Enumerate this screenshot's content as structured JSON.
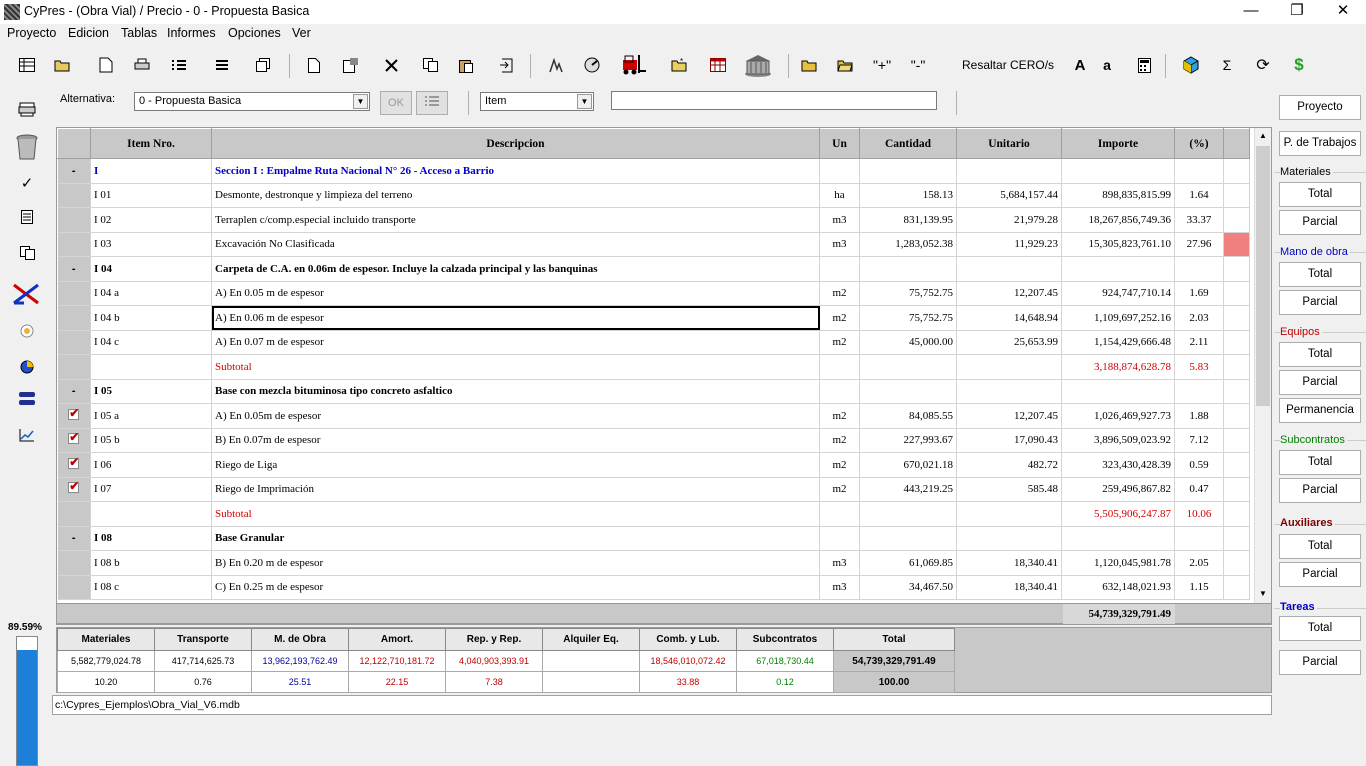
{
  "window": {
    "title": "CyPres  - (Obra Vial) / Precio - 0 - Propuesta Basica",
    "min_icon": "—",
    "max_icon": "❐",
    "close_icon": "✕"
  },
  "menu": [
    "Proyecto",
    "Edicion",
    "Tablas",
    "Informes",
    "Opciones",
    "Ver"
  ],
  "toolbar": {
    "resaltar_label": "Resaltar CERO/s",
    "font_large": "A",
    "font_small": "a",
    "sigma": "Σ",
    "dollar": "$",
    "plus": "\"+\"",
    "minus": "\"-\""
  },
  "alternativa": {
    "label": "Alternativa:",
    "value": "0 - Propuesta Basica",
    "ok_label": "OK",
    "field_value": "Item",
    "search_value": ""
  },
  "grid": {
    "columns": [
      "Item Nro.",
      "Descripcion",
      "Un",
      "Cantidad",
      "Unitario",
      "Importe",
      "(%)"
    ],
    "rows": [
      {
        "type": "section",
        "rh": "-",
        "code": "I",
        "desc": "Seccion I : Empalme Ruta Nacional N° 26 - Acceso a Barrio",
        "un": "",
        "cant": "",
        "unit": "",
        "imp": "",
        "pct": ""
      },
      {
        "type": "item",
        "rh": "",
        "code": "I 01",
        "desc": "Desmonte, destronque y limpieza del terreno",
        "un": "ha",
        "cant": "158.13",
        "unit": "5,684,157.44",
        "imp": "898,835,815.99",
        "pct": "1.64"
      },
      {
        "type": "item",
        "rh": "",
        "code": "I 02",
        "desc": "Terraplen c/comp.especial incluido transporte",
        "un": "m3",
        "cant": "831,139.95",
        "unit": "21,979.28",
        "imp": "18,267,856,749.36",
        "pct": "33.37"
      },
      {
        "type": "item",
        "rh": "",
        "code": "I 03",
        "desc": "Excavación No Clasificada",
        "un": "m3",
        "cant": "1,283,052.38",
        "unit": "11,929.23",
        "imp": "15,305,823,761.10",
        "pct": "27.96",
        "flag": true
      },
      {
        "type": "group",
        "rh": "-",
        "code": "I 04",
        "desc": "Carpeta de C.A. en 0.06m de espesor. Incluye la calzada principal y las banquinas",
        "un": "",
        "cant": "",
        "unit": "",
        "imp": "",
        "pct": ""
      },
      {
        "type": "item",
        "rh": "",
        "code": "I 04 a",
        "desc": "A) En 0.05 m de espesor",
        "un": "m2",
        "cant": "75,752.75",
        "unit": "12,207.45",
        "imp": "924,747,710.14",
        "pct": "1.69"
      },
      {
        "type": "item",
        "rh": "",
        "code": "I 04 b",
        "desc": "A) En 0.06 m de espesor",
        "un": "m2",
        "cant": "75,752.75",
        "unit": "14,648.94",
        "imp": "1,109,697,252.16",
        "pct": "2.03",
        "selected": true
      },
      {
        "type": "item",
        "rh": "",
        "code": "I 04 c",
        "desc": "A) En 0.07 m de espesor",
        "un": "m2",
        "cant": "45,000.00",
        "unit": "25,653.99",
        "imp": "1,154,429,666.48",
        "pct": "2.11"
      },
      {
        "type": "subtotal",
        "rh": "",
        "code": "",
        "desc": "Subtotal",
        "un": "",
        "cant": "",
        "unit": "",
        "imp": "3,188,874,628.78",
        "pct": "5.83"
      },
      {
        "type": "group",
        "rh": "-",
        "code": "I 05",
        "desc": "Base con mezcla bituminosa tipo concreto asfaltico",
        "un": "",
        "cant": "",
        "unit": "",
        "imp": "",
        "pct": ""
      },
      {
        "type": "item",
        "rh": "chk",
        "code": "I 05 a",
        "desc": "A) En 0.05m de espesor",
        "un": "m2",
        "cant": "84,085.55",
        "unit": "12,207.45",
        "imp": "1,026,469,927.73",
        "pct": "1.88"
      },
      {
        "type": "item",
        "rh": "chk",
        "code": "I 05 b",
        "desc": "B) En 0.07m de espesor",
        "un": "m2",
        "cant": "227,993.67",
        "unit": "17,090.43",
        "imp": "3,896,509,023.92",
        "pct": "7.12"
      },
      {
        "type": "item",
        "rh": "chk",
        "code": "I 06",
        "desc": "Riego de Liga",
        "un": "m2",
        "cant": "670,021.18",
        "unit": "482.72",
        "imp": "323,430,428.39",
        "pct": "0.59"
      },
      {
        "type": "item",
        "rh": "chk",
        "code": "I 07",
        "desc": "Riego de Imprimación",
        "un": "m2",
        "cant": "443,219.25",
        "unit": "585.48",
        "imp": "259,496,867.82",
        "pct": "0.47"
      },
      {
        "type": "subtotal",
        "rh": "",
        "code": "",
        "desc": "Subtotal",
        "un": "",
        "cant": "",
        "unit": "",
        "imp": "5,505,906,247.87",
        "pct": "10.06"
      },
      {
        "type": "group",
        "rh": "-",
        "code": "I 08",
        "desc": "Base Granular",
        "un": "",
        "cant": "",
        "unit": "",
        "imp": "",
        "pct": ""
      },
      {
        "type": "item",
        "rh": "",
        "code": "I 08 b",
        "desc": "B) En 0.20 m de espesor",
        "un": "m3",
        "cant": "61,069.85",
        "unit": "18,340.41",
        "imp": "1,120,045,981.78",
        "pct": "2.05"
      },
      {
        "type": "item",
        "rh": "",
        "code": "I 08 c",
        "desc": "C) En 0.25 m de espesor",
        "un": "m3",
        "cant": "34,467.50",
        "unit": "18,340.41",
        "imp": "632,148,021.93",
        "pct": "1.15"
      }
    ],
    "grand_total": "54,739,329,791.49"
  },
  "summary": {
    "headers": [
      "Materiales",
      "Transporte",
      "M. de Obra",
      "Amort.",
      "Rep. y Rep.",
      "Alquiler Eq.",
      "Comb. y Lub.",
      "Subcontratos",
      "Total"
    ],
    "values": [
      "5,582,779,024.78",
      "417,714,625.73",
      "13,962,193,762.49",
      "12,122,710,181.72",
      "4,040,903,393.91",
      "",
      "18,546,010,072.42",
      "67,018,730.44",
      "54,739,329,791.49"
    ],
    "percents": [
      "10.20",
      "0.76",
      "25.51",
      "22.15",
      "7.38",
      "",
      "33.88",
      "0.12",
      "100.00"
    ],
    "colors": [
      "#000000",
      "#000000",
      "#0000a0",
      "#c00000",
      "#c00000",
      "#000000",
      "#c00000",
      "#008000",
      "#000000"
    ]
  },
  "status": {
    "path": "c:\\Cypres_Ejemplos\\Obra_Vial_V6.mdb"
  },
  "left": {
    "percent": "89.59%",
    "percent_value": 89.59
  },
  "right_panel": {
    "proyecto": "Proyecto",
    "p_trabajos": "P. de Trabajos",
    "materiales": "Materiales",
    "mano_obra": "Mano de obra",
    "equipos": "Equipos",
    "subcontratos": "Subcontratos",
    "auxiliares": "Auxiliares",
    "tareas": "Tareas",
    "total": "Total",
    "parcial": "Parcial",
    "permanencia": "Permanencia",
    "colors": {
      "materiales": "#000000",
      "mano_obra": "#0000c0",
      "equipos": "#c00000",
      "subcontratos": "#008000",
      "auxiliares": "#800000",
      "tareas": "#0000c0"
    }
  }
}
